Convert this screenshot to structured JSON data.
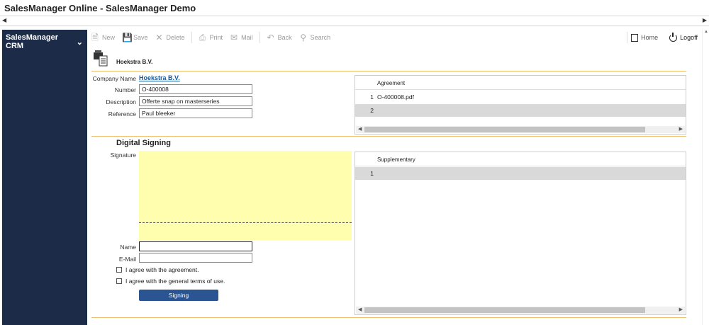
{
  "window": {
    "title": "SalesManager Online - SalesManager Demo"
  },
  "sidebar": {
    "title": "SalesManager CRM"
  },
  "toolbar": {
    "new": "New",
    "save": "Save",
    "delete": "Delete",
    "print": "Print",
    "mail": "Mail",
    "back": "Back",
    "search": "Search",
    "home": "Home",
    "logoff": "Logoff"
  },
  "header": {
    "company": "Hoekstra B.V."
  },
  "form": {
    "company_label": "Company Name",
    "company_value": "Hoekstra B.V.",
    "number_label": "Number",
    "number_value": "O-400008",
    "description_label": "Description",
    "description_value": "Offerte snap on masterseries",
    "reference_label": "Reference",
    "reference_value": "Paul bleeker"
  },
  "agreement_grid": {
    "header": "Agreement",
    "rows": [
      {
        "num": "1",
        "value": "O-400008.pdf"
      },
      {
        "num": "2",
        "value": ""
      }
    ]
  },
  "signing": {
    "title": "Digital Signing",
    "signature_label": "Signature",
    "name_label": "Name",
    "name_value": "",
    "email_label": "E-Mail",
    "email_value": "",
    "agree1": "I agree with the agreement.",
    "agree2": "I agree with the general terms of use.",
    "button": "Signing"
  },
  "supplementary_grid": {
    "header": "Supplementary",
    "rows": [
      {
        "num": "1",
        "value": ""
      }
    ]
  },
  "colors": {
    "sidebar": "#1c2c48",
    "accent_line": "#f0c070",
    "signature_pad": "#fefeae",
    "button": "#2a5592",
    "link": "#1a5aa0"
  }
}
